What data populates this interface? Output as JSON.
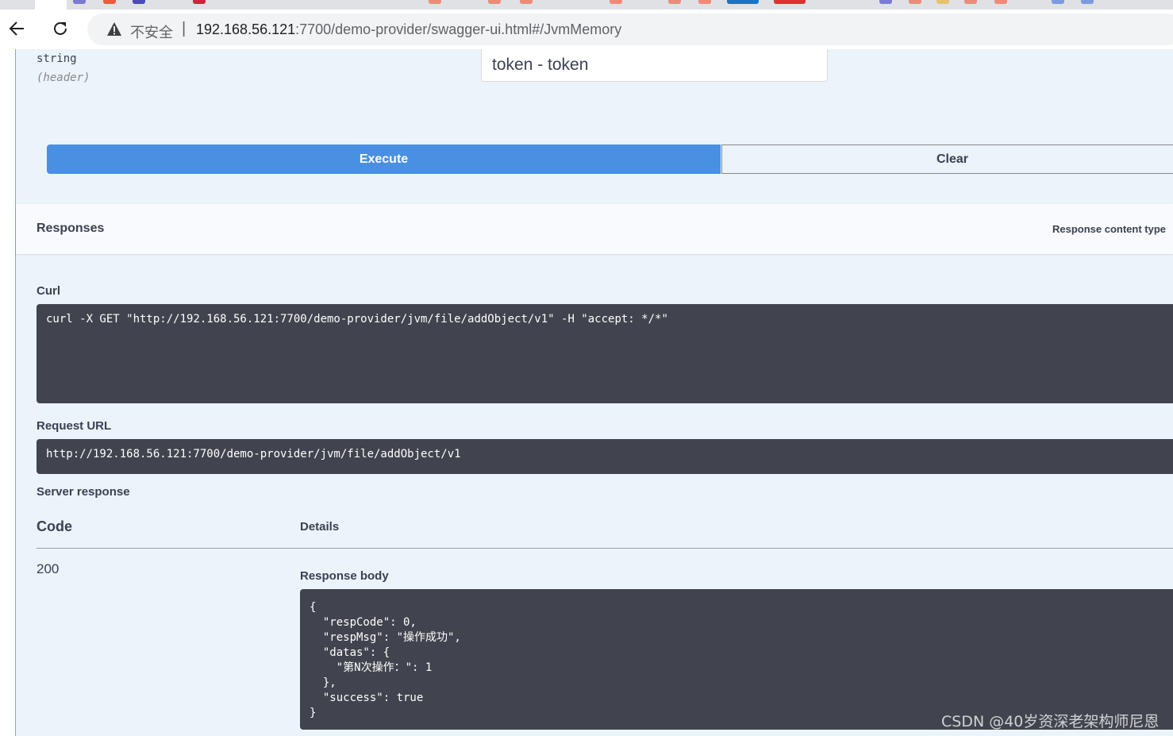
{
  "browser": {
    "security_label": "不安全",
    "separator": "|",
    "url_host": "192.168.56.121",
    "url_rest": ":7700/demo-provider/swagger-ui.html#/JvmMemory"
  },
  "parameter": {
    "type": "string",
    "in": "(header)",
    "value": "token - token"
  },
  "actions": {
    "execute_label": "Execute",
    "clear_label": "Clear"
  },
  "responses": {
    "title": "Responses",
    "content_type_label": "Response content type"
  },
  "curl": {
    "label": "Curl",
    "command": "curl -X GET \"http://192.168.56.121:7700/demo-provider/jvm/file/addObject/v1\" -H \"accept: */*\""
  },
  "request_url": {
    "label": "Request URL",
    "value": "http://192.168.56.121:7700/demo-provider/jvm/file/addObject/v1"
  },
  "server_response": {
    "label": "Server response",
    "code_header": "Code",
    "details_header": "Details",
    "status_code": "200",
    "body_label": "Response body",
    "body": "{\n  \"respCode\": 0,\n  \"respMsg\": \"操作成功\",\n  \"datas\": {\n    \"第N次操作：\": 1\n  },\n  \"success\": true\n}"
  },
  "watermark": "CSDN @40岁资深老架构师尼恩",
  "colors": {
    "execute": "#4990e2",
    "code_bg": "#41444e",
    "opblock_bg": "#ebf3fb"
  }
}
